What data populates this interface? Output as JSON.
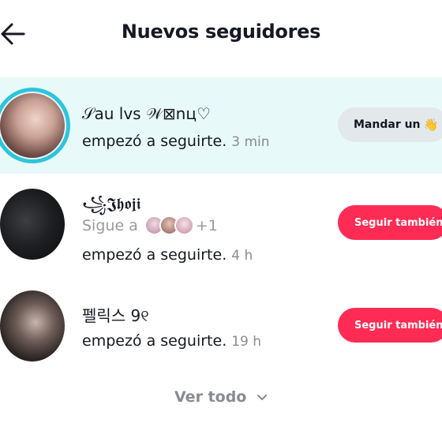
{
  "header": {
    "title": "Nuevos seguidores",
    "back_icon": "arrow-left-icon"
  },
  "colors": {
    "accent_red": "#fe2c55",
    "story_ring": "#2ec4dc",
    "highlight_bg": "#e8f9fa",
    "secondary_text": "#8a8b91"
  },
  "followers": [
    {
      "name": "𝒮au lvs 𝒲⊠nц♡",
      "action_text": "empezó a seguirte.",
      "time": "3 min",
      "button_label": "Mandar un",
      "button_emoji": "👋",
      "highlighted": true,
      "has_story_ring": true
    },
    {
      "name": "꧁𝕵𝖍𝖔𝖏𝖎",
      "mutual_text": "Sigue a",
      "mutual_more": "+1",
      "action_text": "empezó a seguirte.",
      "time": "4 h",
      "button_label": "Seguir también"
    },
    {
      "name": "펠릭스 9୧",
      "action_text": "empezó a seguirte.",
      "time": "19 h",
      "button_label": "Seguir también"
    }
  ],
  "footer": {
    "see_all_label": "Ver todo",
    "chevron_icon": "chevron-down-icon"
  }
}
